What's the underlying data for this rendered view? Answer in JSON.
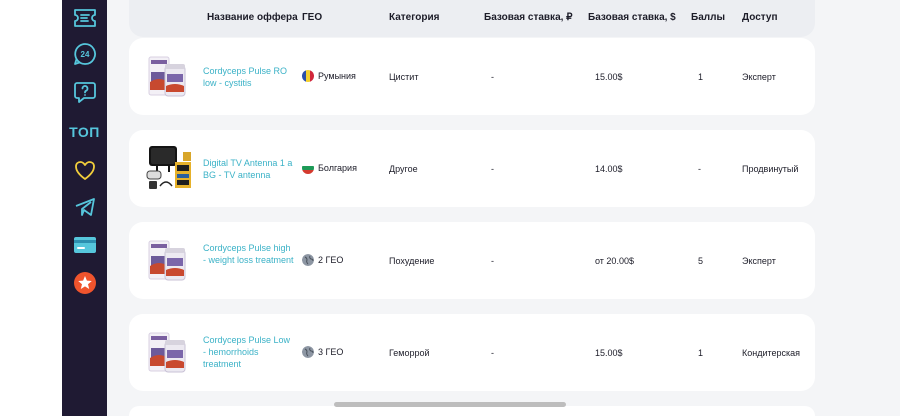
{
  "sidebar": {
    "items": [
      {
        "icon": "ticket-icon"
      },
      {
        "icon": "support-24-7-icon"
      },
      {
        "icon": "help-question-icon"
      },
      {
        "icon": "top-icon",
        "label": "ТОП"
      },
      {
        "icon": "heart-icon"
      },
      {
        "icon": "telegram-icon"
      },
      {
        "icon": "payment-card-icon"
      },
      {
        "icon": "star-badge-icon"
      }
    ]
  },
  "table": {
    "headers": {
      "name": "Название оффера",
      "geo": "ГЕО",
      "category": "Категория",
      "rate_rub": "Базовая ставка, ₽",
      "rate_usd": "Базовая ставка, $",
      "points": "Баллы",
      "access": "Доступ"
    },
    "rows": [
      {
        "name": "Cordyceps Pulse RO low - cystitis",
        "geo": "Румыния",
        "geo_icon": "romania-flag",
        "category": "Цистит",
        "rate_rub": "-",
        "rate_usd": "15.00$",
        "points": "1",
        "access": "Эксперт",
        "thumb": "cordyceps-product-image"
      },
      {
        "name": "Digital TV Antenna 1 a BG - TV antenna",
        "geo": "Болгария",
        "geo_icon": "bulgaria-flag",
        "category": "Другое",
        "rate_rub": "-",
        "rate_usd": "14.00$",
        "points": "-",
        "access": "Продвинутый",
        "thumb": "tv-antenna-product-image"
      },
      {
        "name": "Cordyceps Pulse high - weight loss treatment",
        "geo": "2 ГЕО",
        "geo_icon": "globe-icon",
        "category": "Похудение",
        "rate_rub": "-",
        "rate_usd": "от 20.00$",
        "points": "5",
        "access": "Эксперт",
        "thumb": "cordyceps-product-image"
      },
      {
        "name": "Cordyceps Pulse Low - hemorrhoids treatment",
        "geo": "3 ГЕО",
        "geo_icon": "globe-icon",
        "category": "Геморрой",
        "rate_rub": "-",
        "rate_usd": "15.00$",
        "points": "1",
        "access": "Кондитерская",
        "thumb": "cordyceps-product-image"
      }
    ]
  },
  "colors": {
    "sidebar_bg": "#1f1a33",
    "icon_cyan": "#56c6dc",
    "icon_yellow": "#f2cf3c",
    "link": "#3bb2c7",
    "page_bg": "#f4f5f7"
  }
}
